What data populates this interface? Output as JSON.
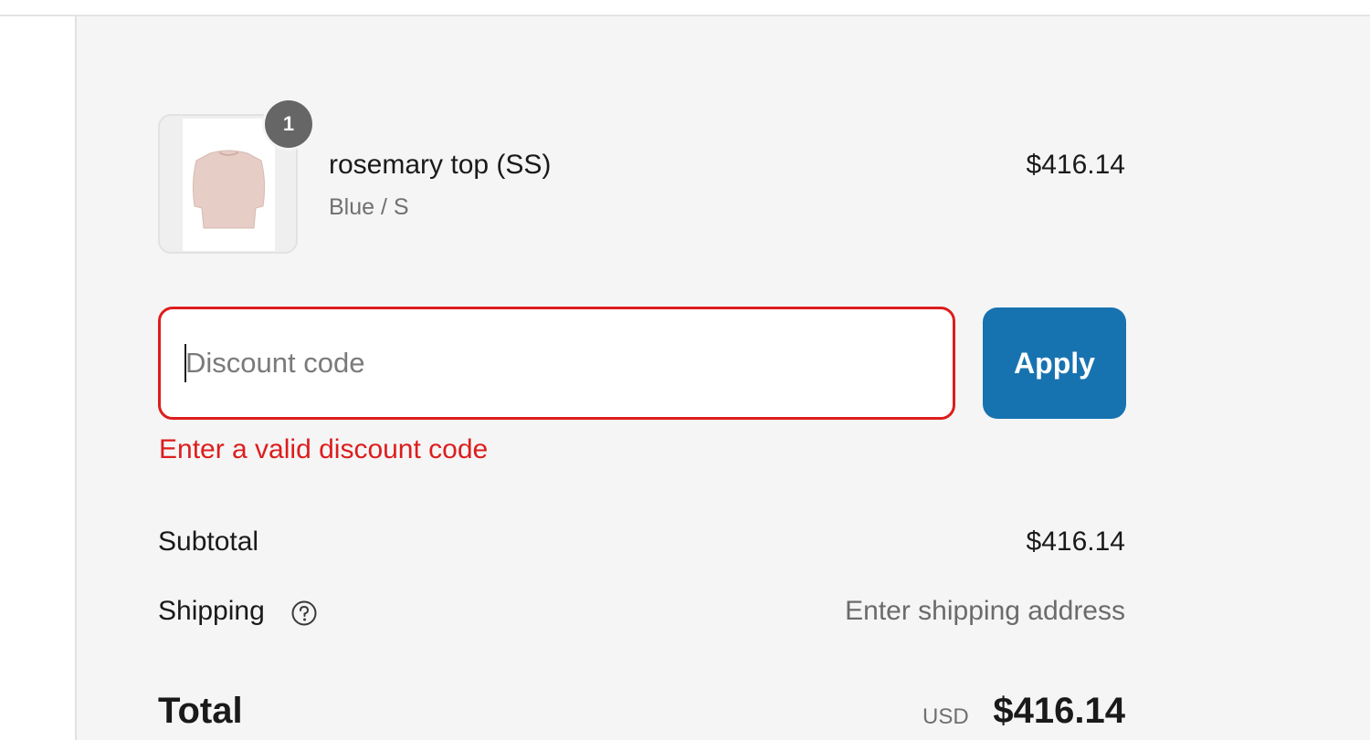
{
  "product": {
    "quantity": "1",
    "name": "rosemary top (SS)",
    "variant": "Blue / S",
    "price": "$416.14",
    "image_icon": "sweater-image"
  },
  "discount": {
    "placeholder": "Discount code",
    "value": "",
    "apply_label": "Apply",
    "error": "Enter a valid discount code"
  },
  "totals": {
    "subtotal_label": "Subtotal",
    "subtotal_value": "$416.14",
    "shipping_label": "Shipping",
    "shipping_icon": "help-circle-icon",
    "shipping_value": "Enter shipping address",
    "total_label": "Total",
    "currency": "USD",
    "total_value": "$416.14"
  },
  "colors": {
    "accent": "#1773b0",
    "error": "#dd1d1d",
    "background": "#f5f5f5"
  }
}
